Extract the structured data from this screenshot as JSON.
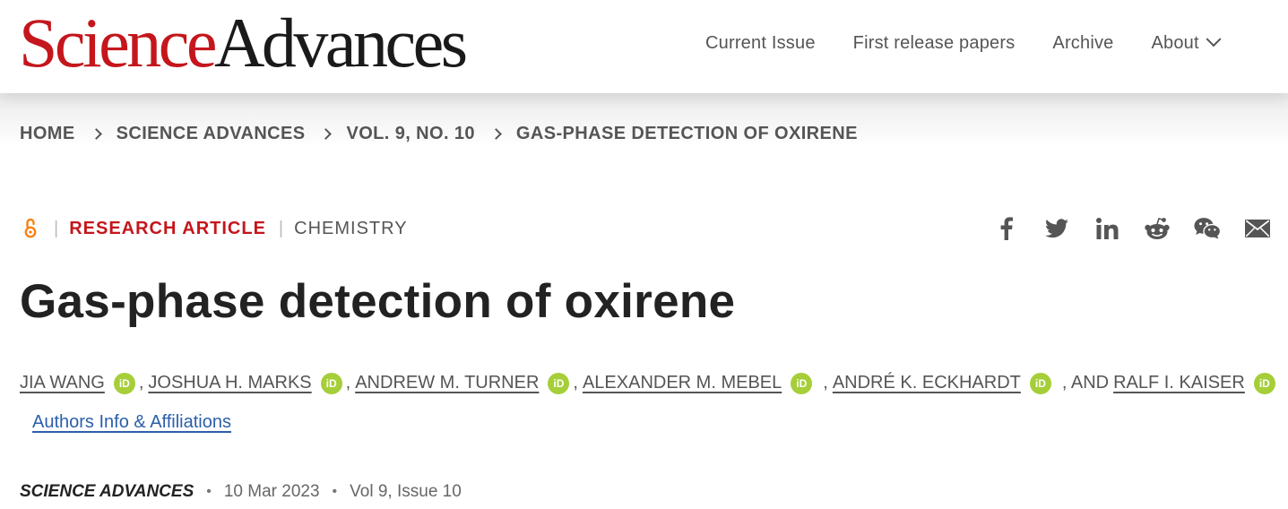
{
  "header": {
    "logo_science": "Science",
    "logo_advances": "Advances",
    "nav": [
      "Current Issue",
      "First release papers",
      "Archive",
      "About"
    ]
  },
  "breadcrumb": [
    "HOME",
    "SCIENCE ADVANCES",
    "VOL. 9, NO. 10",
    "GAS-PHASE DETECTION OF OXIRENE"
  ],
  "article": {
    "access_icon": "open-access-icon",
    "type": "RESEARCH ARTICLE",
    "subject": "CHEMISTRY",
    "title": "Gas-phase detection of oxirene",
    "authors": [
      "JIA WANG",
      "JOSHUA H. MARKS",
      "ANDREW M. TURNER",
      "ALEXANDER M. MEBEL",
      "ANDRÉ K. ECKHARDT",
      "RALF I. KAISER"
    ],
    "orcid_label": "iD",
    "last_author_prefix": ", AND",
    "affiliations_link": "Authors Info & Affiliations",
    "journal": "SCIENCE ADVANCES",
    "date": "10 Mar 2023",
    "volume": "Vol 9, Issue 10"
  },
  "share_icons": [
    "facebook-icon",
    "twitter-icon",
    "linkedin-icon",
    "reddit-icon",
    "wechat-icon",
    "email-icon"
  ],
  "colors": {
    "brand_red": "#c4161c",
    "orcid_green": "#a6ce39",
    "link_blue": "#2b5faa",
    "open_access_orange": "#f68212",
    "muted_text": "#555555"
  }
}
